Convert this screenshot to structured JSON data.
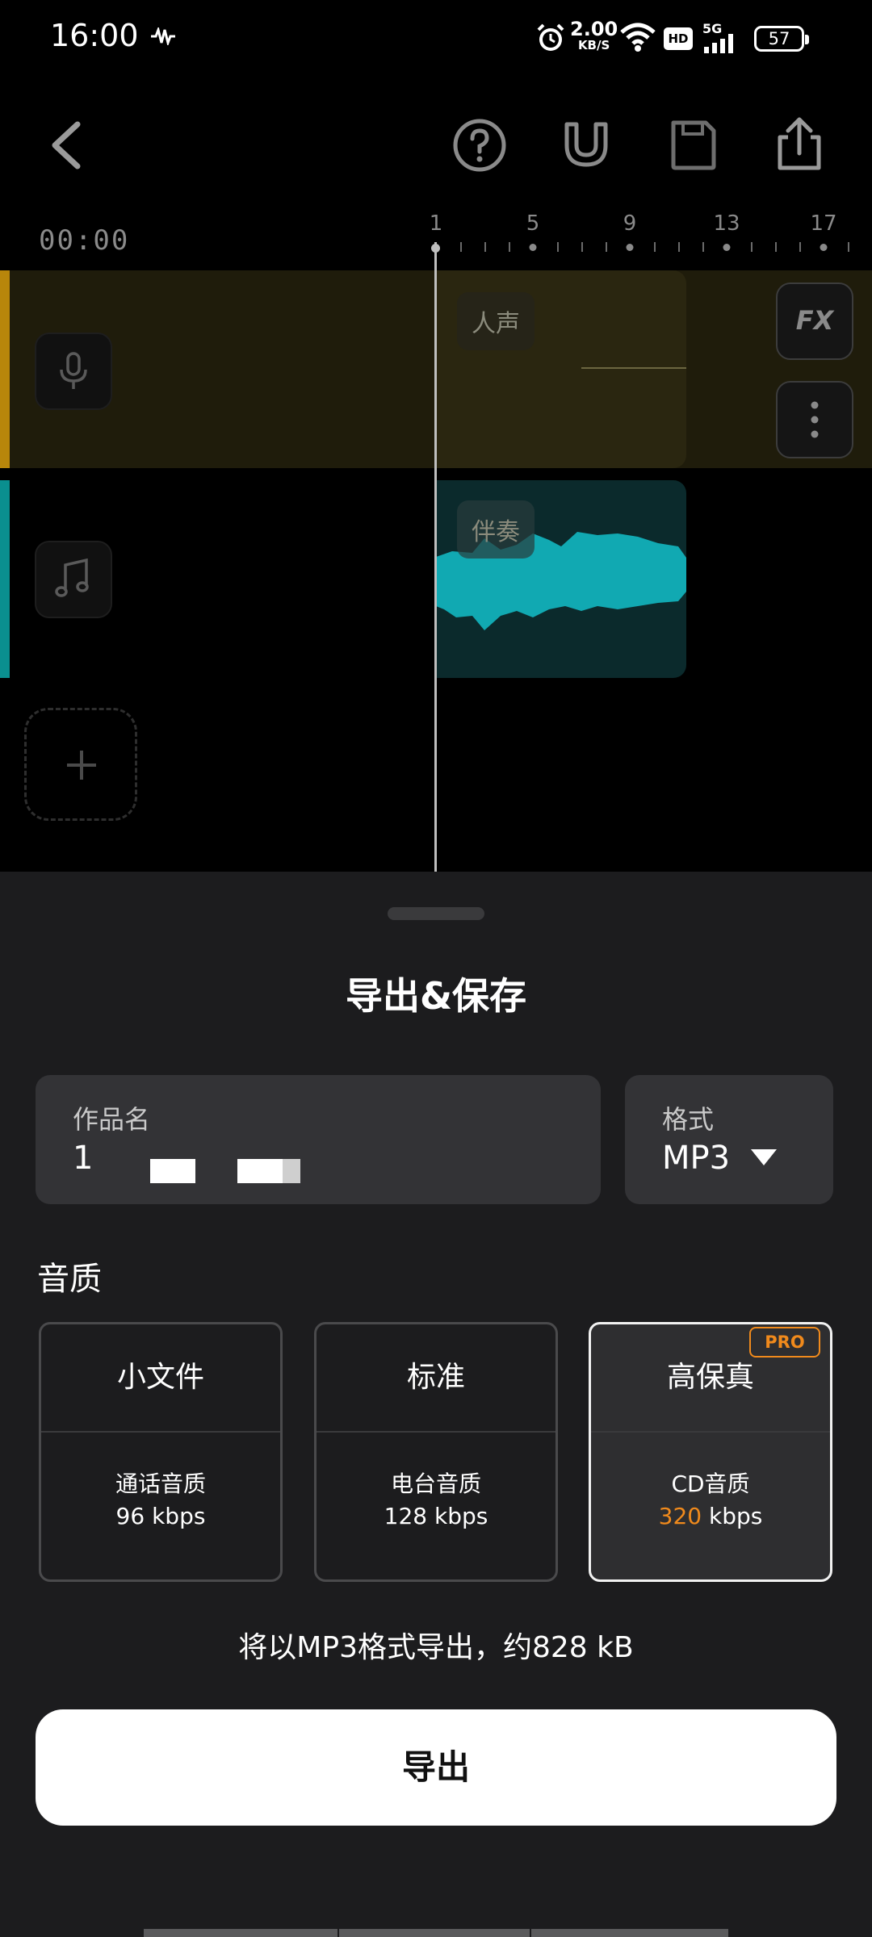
{
  "status_bar": {
    "time": "16:00",
    "network_speed": "2.00",
    "network_speed_unit": "KB/S",
    "hd": "HD",
    "signal": "5G",
    "battery": "57"
  },
  "editor": {
    "time": "00:00",
    "ruler": [
      "1",
      "5",
      "9",
      "13",
      "17"
    ],
    "tracks": [
      {
        "label": "人声",
        "icon": "microphone-icon"
      },
      {
        "label": "伴奏",
        "icon": "music-note-icon"
      }
    ],
    "fx_label": "FX"
  },
  "sheet": {
    "title": "导出&保存",
    "name_field": {
      "label": "作品名",
      "value": "1"
    },
    "format_field": {
      "label": "格式",
      "value": "MP3"
    },
    "quality_label": "音质",
    "quality_options": [
      {
        "title": "小文件",
        "desc": "通话音质",
        "rate": "96 kbps",
        "selected": false
      },
      {
        "title": "标准",
        "desc": "电台音质",
        "rate": "128 kbps",
        "selected": false
      },
      {
        "title": "高保真",
        "desc": "CD音质",
        "rate_value": "320",
        "rate_unit": " kbps",
        "selected": true,
        "badge": "PRO"
      }
    ],
    "info": "将以MP3格式导出，约828 kB",
    "export_button": "导出"
  },
  "colors": {
    "accent": "#f08a1c",
    "vocal_track": "#b8860b",
    "accompaniment_track": "#0a8f8f",
    "sheet_bg": "#1c1c1e"
  }
}
